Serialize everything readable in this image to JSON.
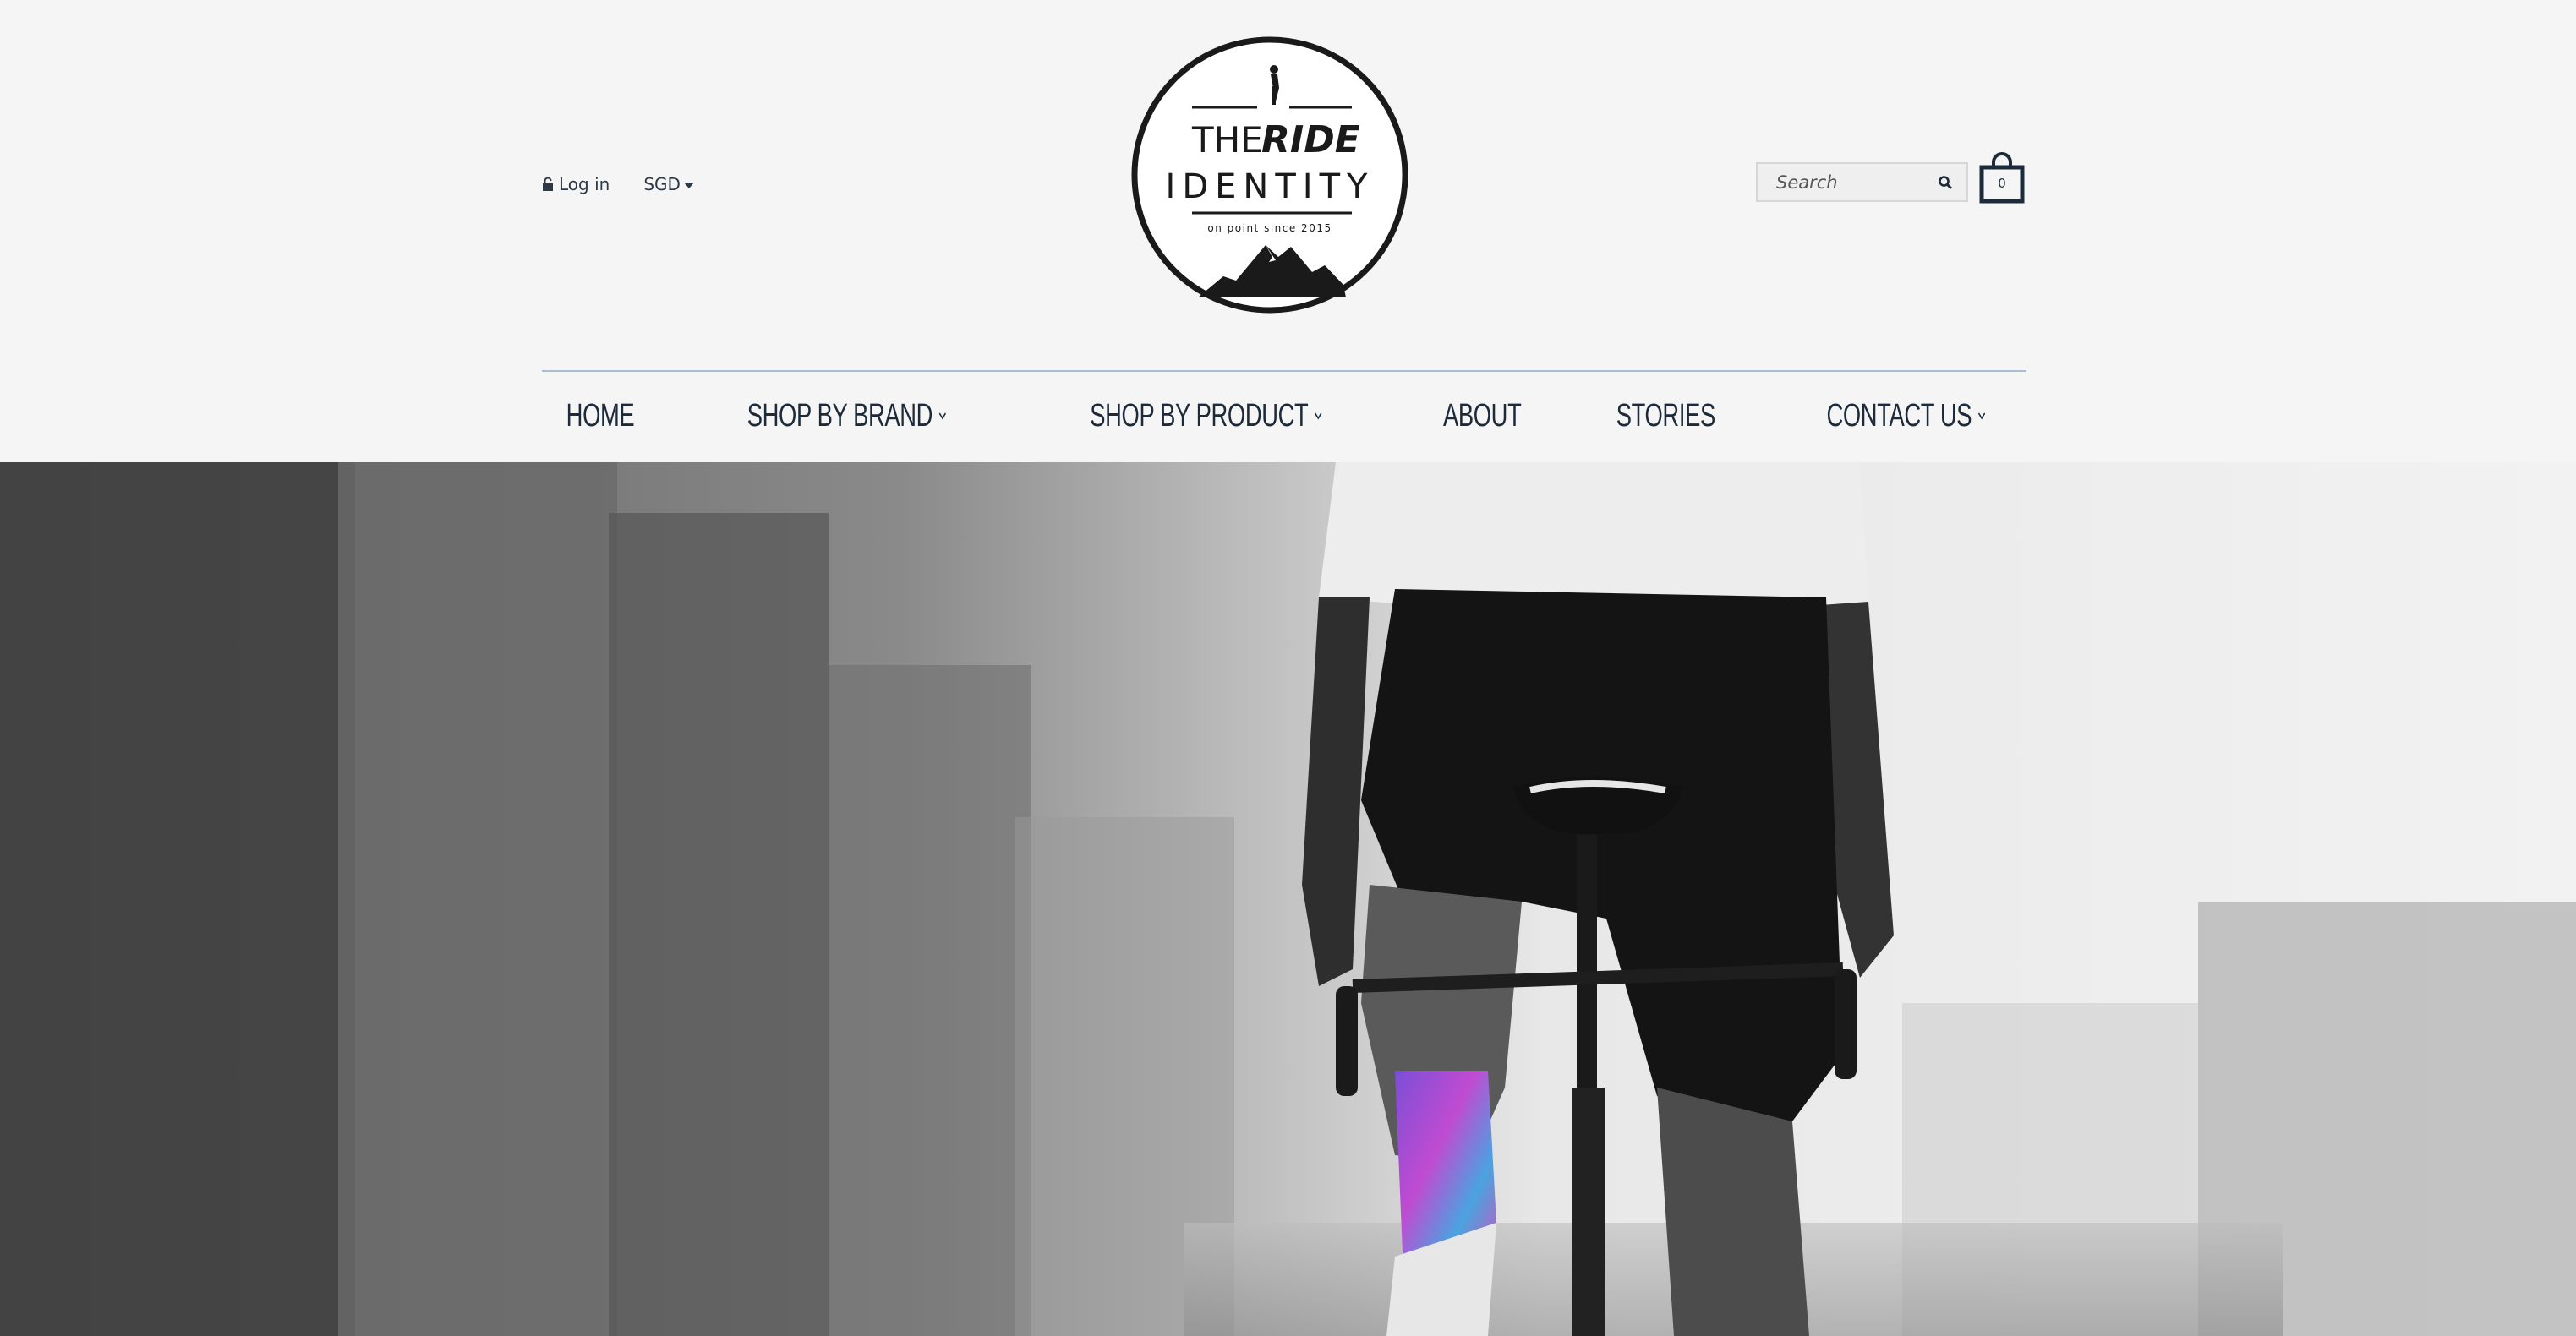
{
  "header": {
    "login_label": "Log in",
    "currency": "SGD",
    "logo": {
      "line1_plain": "THE",
      "line1_bold": "RIDE",
      "line2": "IDENTITY",
      "tagline": "on point since 2015"
    },
    "search_placeholder": "Search",
    "cart_count": "0"
  },
  "nav": {
    "items": [
      {
        "label": "HOME",
        "has_dropdown": false
      },
      {
        "label": "SHOP BY BRAND",
        "has_dropdown": true
      },
      {
        "label": "SHOP BY PRODUCT",
        "has_dropdown": true
      },
      {
        "label": "ABOUT",
        "has_dropdown": false
      },
      {
        "label": "STORIES",
        "has_dropdown": false
      },
      {
        "label": "CONTACT US",
        "has_dropdown": true
      }
    ]
  },
  "colors": {
    "nav_text": "#1c2a3a",
    "nav_rule": "#a9bdd4",
    "header_bg": "#f5f5f5"
  },
  "hero": {
    "description_icon": "cyclist-hero-image"
  }
}
